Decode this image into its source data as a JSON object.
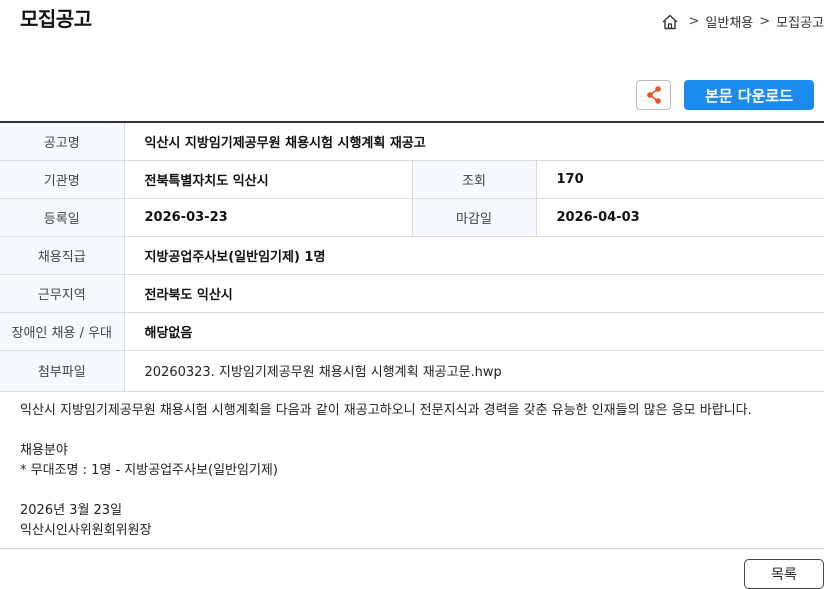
{
  "page_title": "모집공고",
  "breadcrumb": {
    "home_icon": "home-icon",
    "items": [
      "일반채용",
      "모집공고"
    ]
  },
  "actions": {
    "share_icon": "share-icon",
    "download_label": "본문 다운로드",
    "accent_color": "#1a8bef"
  },
  "info": {
    "notice_title_label": "공고명",
    "notice_title": "익산시 지방임기제공무원 채용시험 시행계획 재공고",
    "agency_label": "기관명",
    "agency": "전북특별자치도 익산시",
    "views_label": "조회",
    "views": "170",
    "reg_date_label": "등록일",
    "reg_date": "2026-03-23",
    "deadline_label": "마감일",
    "deadline": "2026-04-03",
    "position_label": "채용직급",
    "position": "지방공업주사보(일반임기제) 1명",
    "region_label": "근무지역",
    "region": "전라북도 익산시",
    "disabled_label": "장애인 채용 / 우대",
    "disabled": "해당없음",
    "attachment_label": "첨부파일",
    "attachment": "20260323. 지방임기제공무원 채용시험 시행계획 재공고문.hwp"
  },
  "body": {
    "line1": "익산시 지방임기제공무원 채용시험 시행계획을 다음과 같이 재공고하오니 전문지식과 경력을 갖춘 유능한 인재들의 많은 응모 바랍니다.",
    "line2": " 채용분야",
    "line3": " * 무대조명 : 1명 - 지방공업주사보(일반임기제)",
    "line4": "2026년 3월 23일",
    "line5": "익산시인사위원회위원장"
  },
  "footer": {
    "list_button": "목록"
  }
}
